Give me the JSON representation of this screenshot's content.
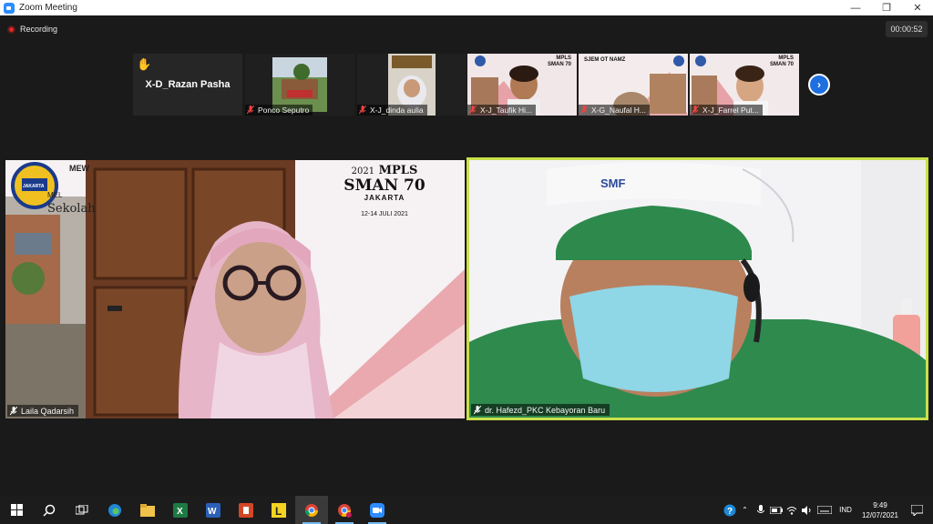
{
  "window": {
    "title": "Zoom Meeting"
  },
  "recording": {
    "label": "Recording"
  },
  "timer": "00:00:52",
  "thumbnails": [
    {
      "name": "X-D_Razan Pasha",
      "hand_raised": true,
      "video": false
    },
    {
      "name": "Ponco Seputro",
      "muted": true
    },
    {
      "name": "X-J_dinda aulia",
      "muted": true
    },
    {
      "name": "X-J_Taufik Hi...",
      "muted": true
    },
    {
      "name": "X-G_Naufal H...",
      "muted": true
    },
    {
      "name": "X-J_Farrel Put...",
      "muted": true
    }
  ],
  "thumb_text": {
    "ttl_bg": "MPLS",
    "ttl_school": "SMAN 70",
    "partial": "SJEM OT NAMZ"
  },
  "main_videos": [
    {
      "name": "Laila Qadarsih",
      "banner_year": "2021",
      "banner_title": "MPLS",
      "banner_school": "SMAN 70",
      "banner_city": "JAKARTA",
      "banner_date": "12-14 JULI 2021",
      "bg_partial_1": "MEW",
      "bg_partial_2": "MEL",
      "bg_partial_3": "Sekolah",
      "logo_text": "JAKARTA"
    },
    {
      "name": "dr. Hafezd_PKC Kebayoran Baru",
      "cap_logo": "SMF"
    }
  ],
  "taskbar": {
    "lang": "IND",
    "time": "9:49",
    "date": "12/07/2021"
  },
  "colors": {
    "active_speaker": "#c9e04a",
    "accent": "#1e6fe0",
    "recording": "#e02828"
  }
}
